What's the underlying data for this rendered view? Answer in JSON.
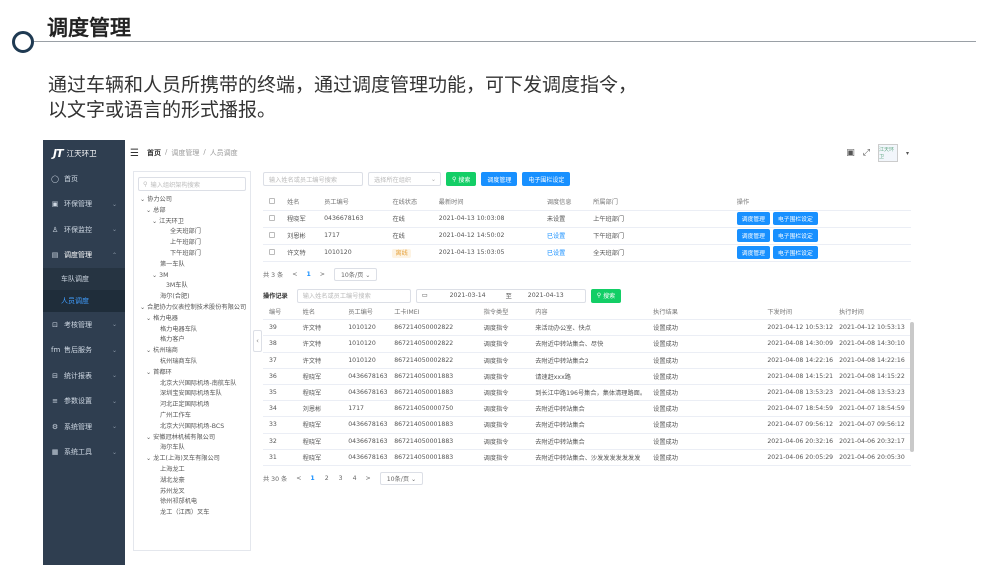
{
  "slide": {
    "title": "调度管理",
    "description": "通过车辆和人员所携带的终端，通过调度管理功能，可下发调度指令，以文字或语言的形式播报。"
  },
  "app": {
    "logo_mark": "JT",
    "logo_text": "江天环卫",
    "nav": [
      {
        "label": "首页",
        "icon": "home-icon",
        "glyph": "◯",
        "caret": ""
      },
      {
        "label": "环保管理",
        "icon": "eco-icon",
        "glyph": "▣",
        "caret": "⌄"
      },
      {
        "label": "环保监控",
        "icon": "monitor-icon",
        "glyph": "♙",
        "caret": "⌄"
      },
      {
        "label": "调度管理",
        "icon": "dispatch-icon",
        "glyph": "▤",
        "caret": "⌃"
      }
    ],
    "nav_sub": [
      {
        "label": "车队调度",
        "active": false
      },
      {
        "label": "人员调度",
        "active": true
      }
    ],
    "nav_rest": [
      {
        "label": "考核管理",
        "icon": "assess-icon",
        "glyph": "⊡",
        "caret": "⌄"
      },
      {
        "label": "售后服务",
        "icon": "service-icon",
        "glyph": "fm",
        "caret": "⌄"
      },
      {
        "label": "统计报表",
        "icon": "report-icon",
        "glyph": "⊟",
        "caret": "⌄"
      },
      {
        "label": "参数设置",
        "icon": "params-icon",
        "glyph": "≡",
        "caret": "⌄"
      },
      {
        "label": "系统管理",
        "icon": "system-icon",
        "glyph": "⚙",
        "caret": "⌄"
      },
      {
        "label": "系统工具",
        "icon": "tools-icon",
        "glyph": "▦",
        "caret": "⌄"
      }
    ],
    "breadcrumb": [
      "首页",
      "调度管理",
      "人员调度"
    ],
    "avatar_text": "江天环卫",
    "tree": {
      "search_placeholder": "输入组织架构搜索",
      "nodes": [
        {
          "text": "⌄ 协力公司",
          "indent": 6
        },
        {
          "text": "⌄ 总部",
          "indent": 12
        },
        {
          "text": "⌄ 江天环卫",
          "indent": 18
        },
        {
          "text": "全天班部门",
          "indent": 36
        },
        {
          "text": "上午班部门",
          "indent": 36
        },
        {
          "text": "下午班部门",
          "indent": 36
        },
        {
          "text": "第一车队",
          "indent": 26
        },
        {
          "text": "⌄ 3M",
          "indent": 18
        },
        {
          "text": "3M车队",
          "indent": 32
        },
        {
          "text": "海尔(合肥)",
          "indent": 26
        },
        {
          "text": "⌄ 合肥协力仪表控制技术股份有限公司",
          "indent": 6
        },
        {
          "text": "⌄ 格力电器",
          "indent": 12
        },
        {
          "text": "格力电器车队",
          "indent": 26
        },
        {
          "text": "格力客户",
          "indent": 26
        },
        {
          "text": "⌄ 杭州瑞商",
          "indent": 12
        },
        {
          "text": "杭州瑞商车队",
          "indent": 26
        },
        {
          "text": "⌄ 首都环",
          "indent": 12
        },
        {
          "text": "北京大兴国际机场-南航车队",
          "indent": 26
        },
        {
          "text": "深圳宝安国际机场车队",
          "indent": 26
        },
        {
          "text": "河北正定国际机场",
          "indent": 26
        },
        {
          "text": "广州工作车",
          "indent": 26
        },
        {
          "text": "北京大兴国际机场-BCS",
          "indent": 26
        },
        {
          "text": "⌄ 安徽冠林机械有限公司",
          "indent": 12
        },
        {
          "text": "海尔车队",
          "indent": 26
        },
        {
          "text": "⌄ 龙工(上海)叉车有限公司",
          "indent": 12
        },
        {
          "text": "上海龙工",
          "indent": 26
        },
        {
          "text": "湖北龙豪",
          "indent": 26
        },
        {
          "text": "苏州龙叉",
          "indent": 26
        },
        {
          "text": "徐州祁邡机电",
          "indent": 26
        },
        {
          "text": "龙工（江西）叉车",
          "indent": 26
        }
      ]
    },
    "filters": {
      "name_placeholder": "输入姓名或员工编号搜索",
      "org_placeholder": "选择所在组织",
      "search_label": "搜索",
      "dispatch_label": "调度管理",
      "fence_label": "电子围栏设定"
    },
    "staff_table": {
      "headers": [
        "",
        "姓名",
        "员工编号",
        "在线状态",
        "最新时间",
        "调度信息",
        "所属部门",
        "操作"
      ],
      "rows": [
        {
          "name": "程晓军",
          "id": "0436678163",
          "status": "在线",
          "status_type": "online",
          "time": "2021-04-13 10:03:08",
          "info": "未设置",
          "info_link": false,
          "dept": "上午班部门"
        },
        {
          "name": "刘恩彬",
          "id": "1717",
          "status": "在线",
          "status_type": "online",
          "time": "2021-04-12 14:50:02",
          "info": "已设置",
          "info_link": true,
          "dept": "下午班部门"
        },
        {
          "name": "许文特",
          "id": "1010120",
          "status": "离线",
          "status_type": "away",
          "time": "2021-04-13 15:03:05",
          "info": "已设置",
          "info_link": true,
          "dept": "全天班部门"
        }
      ],
      "op_dispatch": "调度管理",
      "op_fence": "电子围栏设定"
    },
    "staff_pager": {
      "total": "共 3 条",
      "prev": "<",
      "page": "1",
      "next": ">",
      "size": "10条/页 ⌄"
    },
    "log": {
      "title": "操作记录",
      "name_placeholder": "输入姓名或员工编号搜索",
      "date_from": "2021-03-14",
      "date_sep": "至",
      "date_to": "2021-04-13",
      "search_label": "搜索",
      "headers": [
        "编号",
        "姓名",
        "员工编号",
        "工卡IMEI",
        "指令类型",
        "内容",
        "执行结果",
        "下发时间",
        "执行时间"
      ],
      "rows": [
        [
          "39",
          "许文特",
          "1010120",
          "867214050002822",
          "调度指令",
          "来活动办公室、快点",
          "设置成功",
          "2021-04-12 10:53:12",
          "2021-04-12 10:53:13"
        ],
        [
          "38",
          "许文特",
          "1010120",
          "867214050002822",
          "调度指令",
          "去附近中转站集合、尽快",
          "设置成功",
          "2021-04-08 14:30:09",
          "2021-04-08 14:30:10"
        ],
        [
          "37",
          "许文特",
          "1010120",
          "867214050002822",
          "调度指令",
          "去附近中转站集合2",
          "设置成功",
          "2021-04-08 14:22:16",
          "2021-04-08 14:22:16"
        ],
        [
          "36",
          "程晓军",
          "0436678163",
          "867214050001883",
          "调度指令",
          "请速赶xxx路",
          "设置成功",
          "2021-04-08 14:15:21",
          "2021-04-08 14:15:22"
        ],
        [
          "35",
          "程晓军",
          "0436678163",
          "867214050001883",
          "调度指令",
          "到长江中路196号集合，集体清理路面。",
          "设置成功",
          "2021-04-08 13:53:23",
          "2021-04-08 13:53:23"
        ],
        [
          "34",
          "刘恩彬",
          "1717",
          "867214050000750",
          "调度指令",
          "去附近中转站集合",
          "设置成功",
          "2021-04-07 18:54:59",
          "2021-04-07 18:54:59"
        ],
        [
          "33",
          "程晓军",
          "0436678163",
          "867214050001883",
          "调度指令",
          "去附近中转站集合",
          "设置成功",
          "2021-04-07 09:56:12",
          "2021-04-07 09:56:12"
        ],
        [
          "32",
          "程晓军",
          "0436678163",
          "867214050001883",
          "调度指令",
          "去附近中转站集合",
          "设置成功",
          "2021-04-06 20:32:16",
          "2021-04-06 20:32:17"
        ],
        [
          "31",
          "程晓军",
          "0436678163",
          "867214050001883",
          "调度指令",
          "去附近中转站集合、沙发发发发发发发",
          "设置成功",
          "2021-04-06 20:05:29",
          "2021-04-06 20:05:30"
        ]
      ]
    },
    "log_pager": {
      "total": "共 30 条",
      "prev": "<",
      "pages": [
        "1",
        "2",
        "3",
        "4"
      ],
      "next": ">",
      "size": "10条/页 ⌄"
    }
  }
}
